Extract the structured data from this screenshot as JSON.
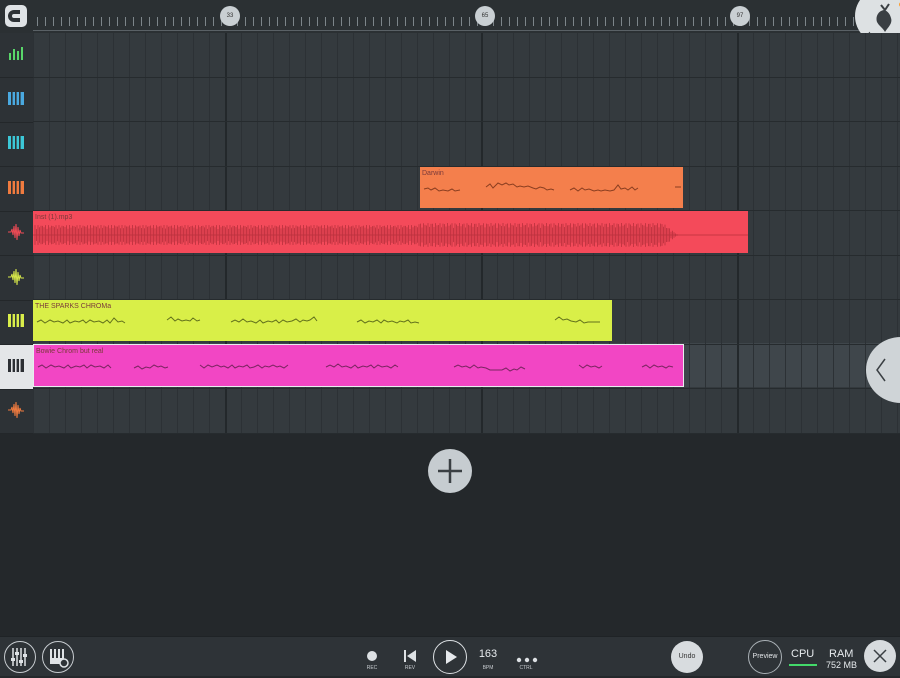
{
  "ruler": {
    "markers": [
      "33",
      "65",
      "97"
    ]
  },
  "tracks": [
    {
      "icon": "mixer-icon",
      "color": "#59d66a",
      "name": ""
    },
    {
      "icon": "piano-keys-icon",
      "color": "#4aa9e0",
      "name": ""
    },
    {
      "icon": "piano-keys-icon",
      "color": "#3cc8d8",
      "name": ""
    },
    {
      "icon": "piano-keys-icon",
      "color": "#f07b3f",
      "name": ""
    },
    {
      "icon": "audio-waveform-icon",
      "color": "#f04a55",
      "name": ""
    },
    {
      "icon": "audio-waveform-icon",
      "color": "#d7e84a",
      "name": ""
    },
    {
      "icon": "piano-keys-icon",
      "color": "#d9ee4a",
      "name": ""
    },
    {
      "icon": "piano-keys-icon",
      "color": "#f046c0",
      "name": ""
    },
    {
      "icon": "audio-waveform-icon",
      "color": "#f07b3f",
      "name": ""
    }
  ],
  "clips": [
    {
      "name": "Darwin",
      "color": "#f47f4c",
      "track": 3
    },
    {
      "name": "Inst (1).mp3",
      "color": "#f44a5a",
      "track": 4
    },
    {
      "name": "THE SPARKS CHROMa",
      "color": "#d9ef48",
      "track": 6
    },
    {
      "name": "Bowie Chrom but real",
      "color": "#f246c4",
      "track": 7
    }
  ],
  "transport": {
    "rec_label": "REC",
    "rev_label": "REV",
    "bpm_value": "163",
    "bpm_label": "BPM",
    "ctrl_label": "CTRL"
  },
  "right_controls": {
    "undo_label": "Undo",
    "preview_label": "Preview",
    "cpu_label": "CPU",
    "ram_label": "RAM",
    "ram_value": "752 MB"
  },
  "colors": {
    "accent_green": "#43d96a",
    "logo_orange": "#ff9c2a"
  }
}
